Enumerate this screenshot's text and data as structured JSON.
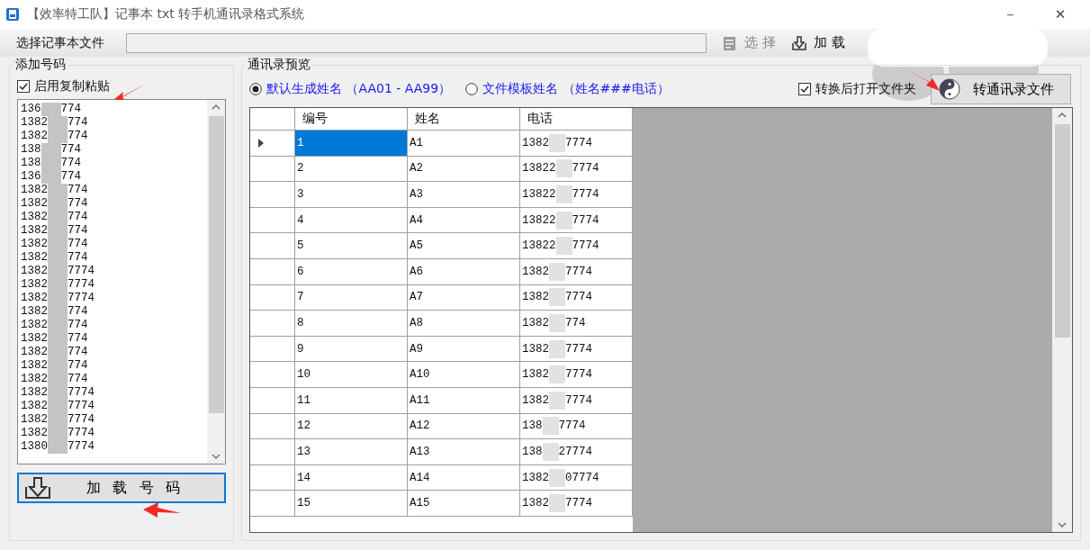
{
  "window": {
    "title": "【效率特工队】记事本 txt 转手机通讯录格式系统",
    "controls": [
      "－",
      "✕"
    ]
  },
  "toolbar": {
    "file_label": "选择记事本文件",
    "select_button": "选 择",
    "load_button": "加 载"
  },
  "add_numbers": {
    "title": "添加号码",
    "paste": {
      "label": "启用复制粘贴",
      "checked": true
    },
    "lines": [
      {
        "start": "136",
        "end": "774"
      },
      {
        "start": "1382",
        "end": "774"
      },
      {
        "start": "1382",
        "end": "774"
      },
      {
        "start": "138",
        "end": "774"
      },
      {
        "start": "138",
        "end": "774"
      },
      {
        "start": "136",
        "end": "774"
      },
      {
        "start": "1382",
        "end": "774"
      },
      {
        "start": "1382",
        "end": "774"
      },
      {
        "start": "1382",
        "end": "774"
      },
      {
        "start": "1382",
        "end": "774"
      },
      {
        "start": "1382",
        "end": "774"
      },
      {
        "start": "1382",
        "end": "774"
      },
      {
        "start": "1382",
        "end": "7774"
      },
      {
        "start": "1382",
        "end": "7774"
      },
      {
        "start": "1382",
        "end": "7774"
      },
      {
        "start": "1382",
        "end": "774"
      },
      {
        "start": "1382",
        "end": "774"
      },
      {
        "start": "1382",
        "end": "774"
      },
      {
        "start": "1382",
        "end": "774"
      },
      {
        "start": "1382",
        "end": "774"
      },
      {
        "start": "1382",
        "end": "774"
      },
      {
        "start": "1382",
        "end": "7774"
      },
      {
        "start": "1382",
        "end": "7774"
      },
      {
        "start": "1382",
        "end": "7774"
      },
      {
        "start": "1382",
        "end": "7774"
      },
      {
        "start": "1380",
        "end": "7774"
      }
    ],
    "load_button": "加 载 号 码"
  },
  "preview": {
    "title": "通讯录预览",
    "name_modes": [
      {
        "label": "默认生成姓名 （AA01 - AA99）",
        "selected": true
      },
      {
        "label": "文件模板姓名 （姓名###电话）",
        "selected": false
      }
    ],
    "open_folder": {
      "label": "转换后打开文件夹",
      "checked": true
    },
    "convert_button": "转通讯录文件",
    "table": {
      "columns": [
        "编号",
        "姓名",
        "电话"
      ],
      "rows": [
        {
          "number": "1",
          "name": "A1",
          "phone_start": "1382",
          "phone_end": "7774",
          "selected": true
        },
        {
          "number": "2",
          "name": "A2",
          "phone_start": "13822",
          "phone_end": "7774",
          "selected": false
        },
        {
          "number": "3",
          "name": "A3",
          "phone_start": "13822",
          "phone_end": "7774",
          "selected": false
        },
        {
          "number": "4",
          "name": "A4",
          "phone_start": "13822",
          "phone_end": "7774",
          "selected": false
        },
        {
          "number": "5",
          "name": "A5",
          "phone_start": "13822",
          "phone_end": "7774",
          "selected": false
        },
        {
          "number": "6",
          "name": "A6",
          "phone_start": "1382",
          "phone_end": "7774",
          "selected": false
        },
        {
          "number": "7",
          "name": "A7",
          "phone_start": "1382",
          "phone_end": "7774",
          "selected": false
        },
        {
          "number": "8",
          "name": "A8",
          "phone_start": "1382",
          "phone_end": "774",
          "selected": false
        },
        {
          "number": "9",
          "name": "A9",
          "phone_start": "1382",
          "phone_end": "7774",
          "selected": false
        },
        {
          "number": "10",
          "name": "A10",
          "phone_start": "1382",
          "phone_end": "7774",
          "selected": false
        },
        {
          "number": "11",
          "name": "A11",
          "phone_start": "1382",
          "phone_end": "7774",
          "selected": false
        },
        {
          "number": "12",
          "name": "A12",
          "phone_start": "138",
          "phone_end": "7774",
          "selected": false
        },
        {
          "number": "13",
          "name": "A13",
          "phone_start": "138",
          "phone_end": "27774",
          "selected": false
        },
        {
          "number": "14",
          "name": "A14",
          "phone_start": "1382",
          "phone_end": "07774",
          "selected": false
        },
        {
          "number": "15",
          "name": "A15",
          "phone_start": "1382",
          "phone_end": "7774",
          "selected": false
        }
      ]
    }
  }
}
